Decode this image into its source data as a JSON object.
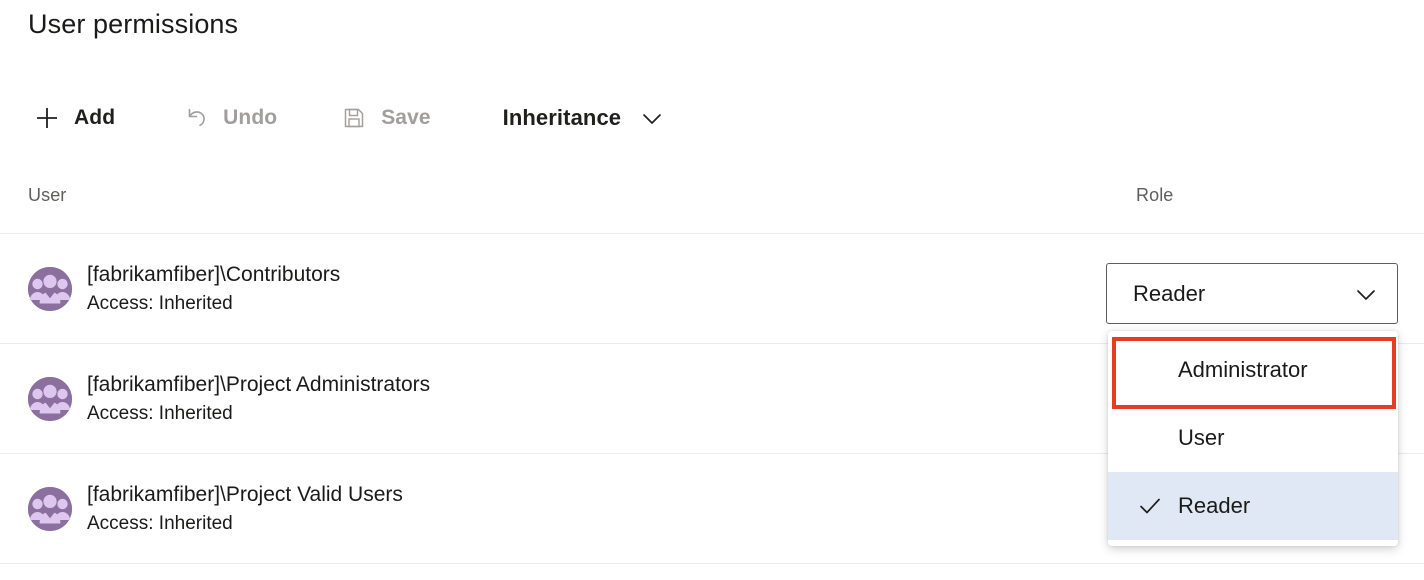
{
  "header": {
    "title": "User permissions"
  },
  "toolbar": {
    "add": {
      "label": "Add",
      "icon": "plus-icon",
      "disabled": false
    },
    "undo": {
      "label": "Undo",
      "icon": "undo-icon",
      "disabled": true
    },
    "save": {
      "label": "Save",
      "icon": "save-icon",
      "disabled": true
    },
    "inheritance": {
      "label": "Inheritance",
      "icon": "chevron-down-icon",
      "disabled": false
    }
  },
  "table": {
    "columns": [
      "User",
      "Role"
    ],
    "rows": [
      {
        "name": "[fabrikamfiber]\\Contributors",
        "access": "Access: Inherited",
        "avatar": "group-avatar-icon",
        "role": "Reader"
      },
      {
        "name": "[fabrikamfiber]\\Project Administrators",
        "access": "Access: Inherited",
        "avatar": "group-avatar-icon",
        "role": ""
      },
      {
        "name": "[fabrikamfiber]\\Project Valid Users",
        "access": "Access: Inherited",
        "avatar": "group-avatar-icon",
        "role": ""
      }
    ]
  },
  "role_combobox": {
    "value": "Reader",
    "expanded": true,
    "options": [
      {
        "label": "Administrator",
        "selected": false,
        "highlighted": true
      },
      {
        "label": "User",
        "selected": false,
        "highlighted": false
      },
      {
        "label": "Reader",
        "selected": true,
        "highlighted": false
      }
    ]
  },
  "colors": {
    "avatar_circle": "#8b6f9e",
    "avatar_figure": "#dec7ef",
    "annotation_red": "#e63c22",
    "selected_row": "#dfe8f4",
    "disabled_text": "#a19f9d",
    "header_text": "#605e5c",
    "border": "#edebe9"
  }
}
